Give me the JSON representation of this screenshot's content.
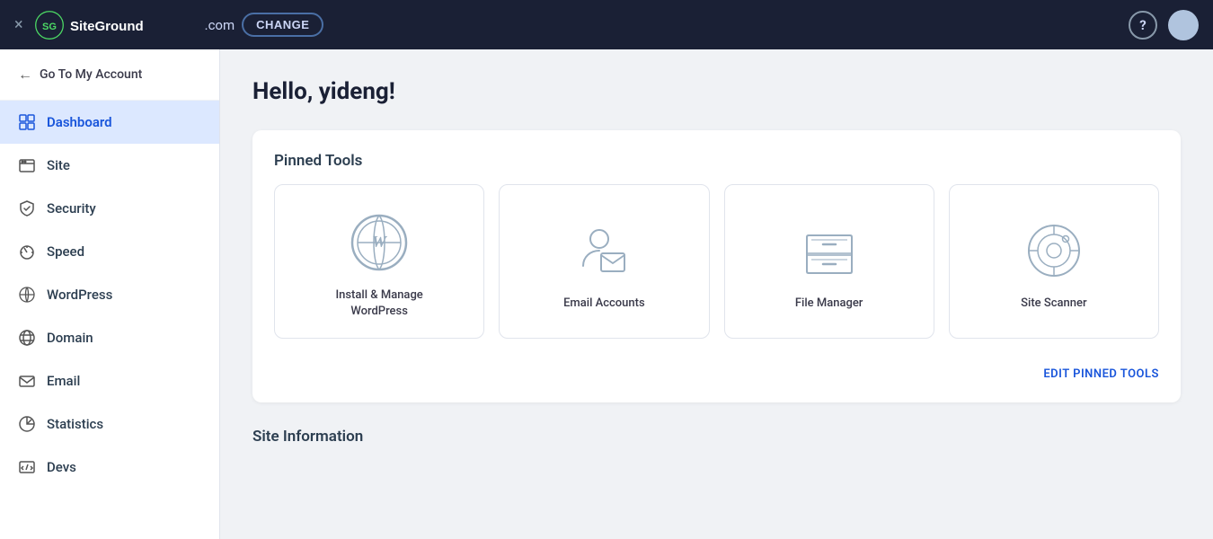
{
  "topnav": {
    "domain": ".com",
    "change_label": "CHANGE",
    "help_label": "?",
    "close_icon": "×"
  },
  "sidebar": {
    "go_to_account": "Go To My Account",
    "items": [
      {
        "id": "dashboard",
        "label": "Dashboard",
        "active": true
      },
      {
        "id": "site",
        "label": "Site",
        "active": false
      },
      {
        "id": "security",
        "label": "Security",
        "active": false
      },
      {
        "id": "speed",
        "label": "Speed",
        "active": false
      },
      {
        "id": "wordpress",
        "label": "WordPress",
        "active": false
      },
      {
        "id": "domain",
        "label": "Domain",
        "active": false
      },
      {
        "id": "email",
        "label": "Email",
        "active": false
      },
      {
        "id": "statistics",
        "label": "Statistics",
        "active": false
      },
      {
        "id": "devs",
        "label": "Devs",
        "active": false
      }
    ]
  },
  "main": {
    "greeting": "Hello, yideng!",
    "pinned_tools_title": "Pinned Tools",
    "pinned_tools": [
      {
        "id": "wordpress",
        "label": "Install & Manage\nWordPress"
      },
      {
        "id": "email",
        "label": "Email Accounts"
      },
      {
        "id": "filemanager",
        "label": "File Manager"
      },
      {
        "id": "sitescanner",
        "label": "Site Scanner"
      }
    ],
    "edit_pinned_label": "EDIT PINNED TOOLS",
    "site_info_title": "Site Information"
  }
}
